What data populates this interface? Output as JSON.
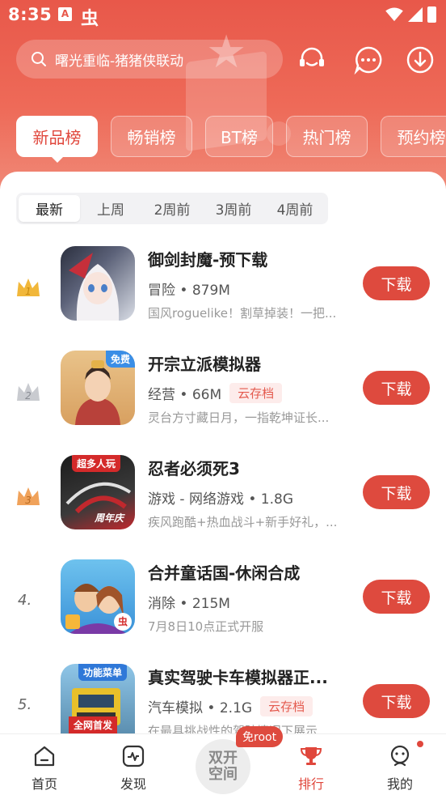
{
  "status_bar": {
    "time": "8:35",
    "app_glyph": "虫",
    "notif_glyph": "A"
  },
  "search": {
    "placeholder": "曙光重临-猪猪侠联动"
  },
  "category_tabs": [
    "新品榜",
    "畅销榜",
    "BT榜",
    "热门榜",
    "预约榜"
  ],
  "period_tabs": [
    "最新",
    "上周",
    "2周前",
    "3周前",
    "4周前"
  ],
  "apps": [
    {
      "rank": "1",
      "rank_style": "gold-crown",
      "title": "御剑封魔-预下载",
      "category": "冒险",
      "size": "879M",
      "tag": "",
      "desc": "国风roguelike！割草掉装！一把...",
      "button": "下载",
      "icon_badge": ""
    },
    {
      "rank": "2",
      "rank_style": "silver-crown",
      "title": "开宗立派模拟器",
      "category": "经营",
      "size": "66M",
      "tag": "云存档",
      "desc": "灵台方寸藏日月，一指乾坤证长...",
      "button": "下载",
      "icon_badge": "免费"
    },
    {
      "rank": "3",
      "rank_style": "bronze-crown",
      "title": "忍者必须死3",
      "category": "游戏 - 网络游戏",
      "size": "1.8G",
      "tag": "",
      "desc": "疾风跑酷+热血战斗+新手好礼，...",
      "button": "下载",
      "icon_badge": "超多人玩",
      "icon_caption": "周年庆"
    },
    {
      "rank": "4.",
      "rank_style": "number",
      "title": "合并童话国-休闲合成",
      "category": "消除",
      "size": "215M",
      "tag": "",
      "desc": "7月8日10点正式开服",
      "button": "下载",
      "icon_badge": "",
      "icon_caption": "虫"
    },
    {
      "rank": "5.",
      "rank_style": "number",
      "title": "真实驾驶卡车模拟器正...",
      "category": "汽车模拟",
      "size": "2.1G",
      "tag": "云存档",
      "desc": "在最具挑战性的驾驶情况下展示...",
      "button": "下载",
      "icon_badge": "功能菜单",
      "icon_caption": "全网首发"
    }
  ],
  "bottom_nav": {
    "home": "首页",
    "discover": "发现",
    "center_label": "双开空间",
    "center_badge": "免root",
    "rank": "排行",
    "me": "我的"
  },
  "colors": {
    "accent": "#de4a3e",
    "hero_top": "#e8584a",
    "tag_bg": "#fdeceb"
  }
}
